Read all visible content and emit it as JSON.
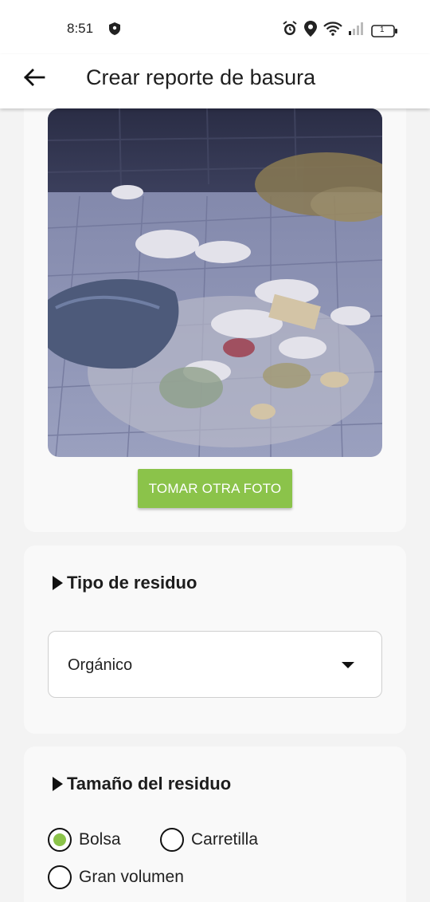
{
  "status_bar": {
    "time": "8:51",
    "battery": "1"
  },
  "app_bar": {
    "title": "Crear reporte de basura",
    "back_icon": "arrow-left-icon"
  },
  "photo_section": {
    "retake_label": "TOMAR OTRA FOTO"
  },
  "type_section": {
    "title": "Tipo de residuo",
    "selected": "Orgánico"
  },
  "size_section": {
    "title": "Tamaño del residuo",
    "options": [
      {
        "label": "Bolsa",
        "selected": true
      },
      {
        "label": "Carretilla",
        "selected": false
      },
      {
        "label": "Gran volumen",
        "selected": false
      }
    ]
  },
  "colors": {
    "accent": "#8bc34a"
  }
}
